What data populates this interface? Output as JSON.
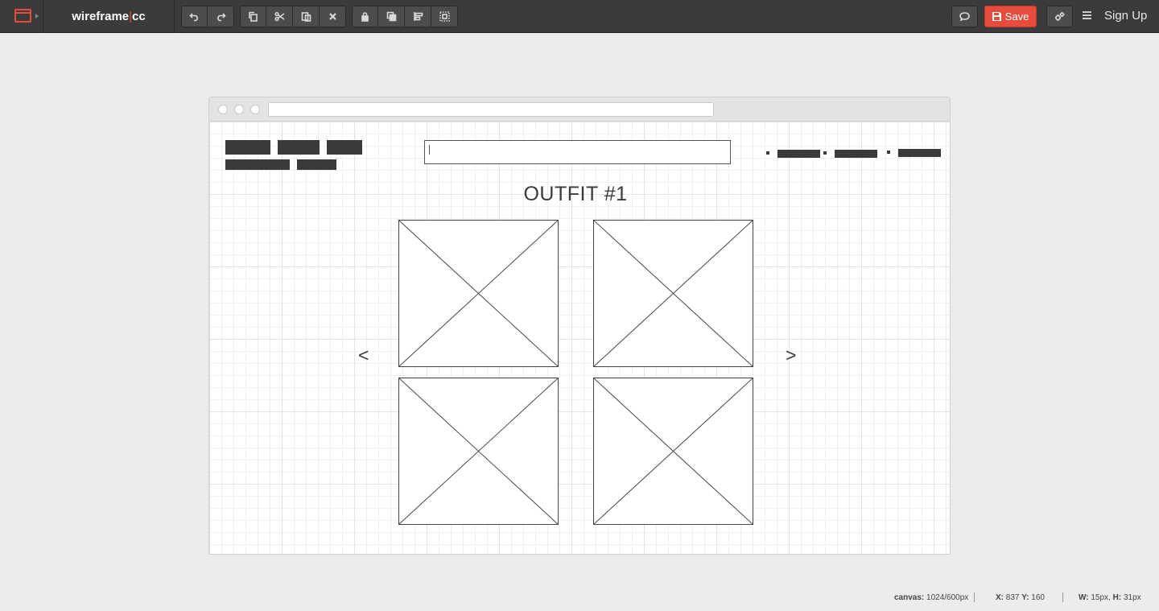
{
  "app": {
    "brand_left": "wireframe",
    "brand_sep": "|",
    "brand_right": "cc"
  },
  "toolbar": {
    "groups": [
      [
        "undo-icon",
        "redo-icon"
      ],
      [
        "copy-icon",
        "cut-icon",
        "paste-icon",
        "delete-icon"
      ],
      [
        "lock-icon",
        "arrange-icon",
        "align-icon",
        "group-icon"
      ]
    ],
    "comment_icon": "comment-icon",
    "save_label": "Save",
    "settings_icon": "settings-icon",
    "menu_icon": "hamburger-menu-icon",
    "signup_label": "Sign Up"
  },
  "canvas": {
    "title": "OUTFIT #1",
    "prev_label": "<",
    "next_label": ">",
    "search_value": ""
  },
  "status": {
    "canvas_label": "canvas:",
    "canvas_value": "1024/600px",
    "x_label": "X:",
    "x_value": "837",
    "y_label": "Y:",
    "y_value": "160",
    "w_label": "W:",
    "w_value": "15px,",
    "h_label": "H:",
    "h_value": "31px"
  },
  "colors": {
    "topbar": "#3b3b3b",
    "accent": "#e74c3c",
    "canvas_bg": "#ececec",
    "element_fill": "#3a3a3a"
  }
}
